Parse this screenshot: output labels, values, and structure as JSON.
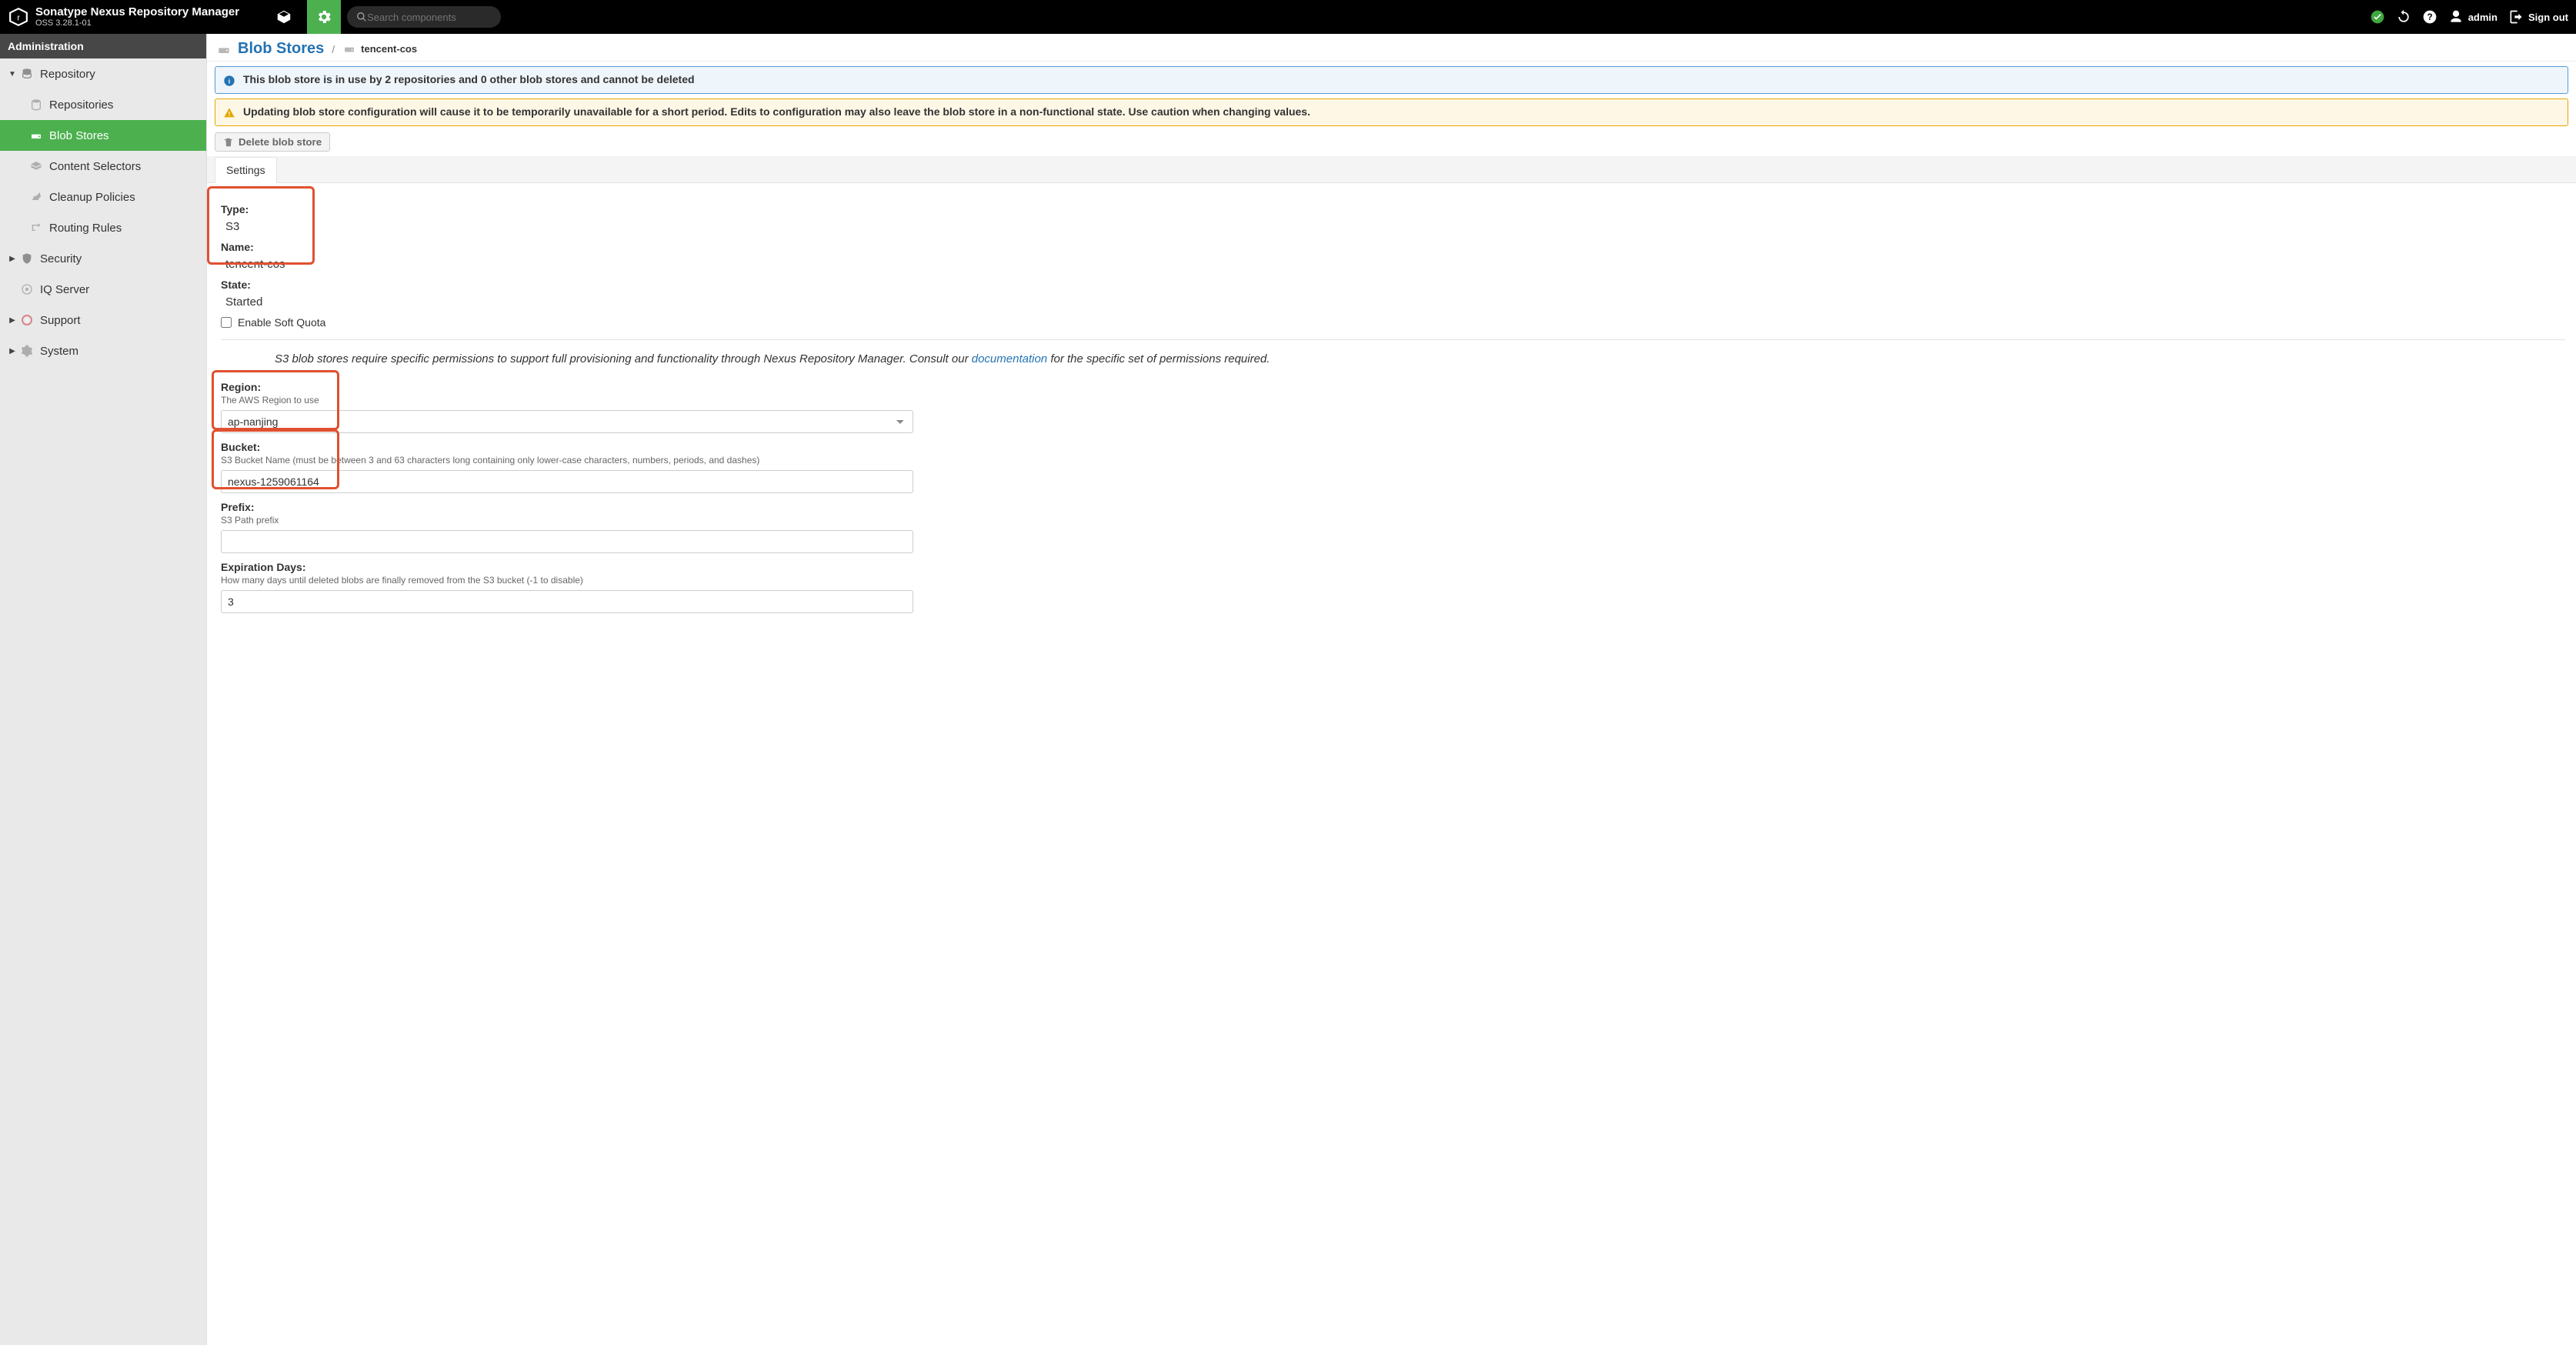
{
  "header": {
    "product_title": "Sonatype Nexus Repository Manager",
    "product_version": "OSS 3.28.1-01",
    "search_placeholder": "Search components",
    "user_label": "admin",
    "signout_label": "Sign out"
  },
  "sidebar": {
    "title": "Administration",
    "tree": {
      "repository": {
        "label": "Repository",
        "expanded": true,
        "children": {
          "repositories": "Repositories",
          "blobstores": "Blob Stores",
          "contentselectors": "Content Selectors",
          "cleanup": "Cleanup Policies",
          "routing": "Routing Rules"
        }
      },
      "security": {
        "label": "Security"
      },
      "iqserver": {
        "label": "IQ Server"
      },
      "support": {
        "label": "Support"
      },
      "system": {
        "label": "System"
      }
    }
  },
  "breadcrumb": {
    "section": "Blob Stores",
    "item": "tencent-cos"
  },
  "alerts": {
    "info_text": "This blob store is in use by 2 repositories and 0 other blob stores and cannot be deleted",
    "warn_text": "Updating blob store configuration will cause it to be temporarily unavailable for a short period. Edits to configuration may also leave the blob store in a non-functional state. Use caution when changing values."
  },
  "actions": {
    "delete_label": "Delete blob store"
  },
  "tabs": {
    "settings": "Settings"
  },
  "form": {
    "type": {
      "label": "Type:",
      "value": "S3"
    },
    "name": {
      "label": "Name:",
      "value": "tencent-cos"
    },
    "state": {
      "label": "State:",
      "value": "Started"
    },
    "soft_quota": {
      "label": "Enable Soft Quota"
    },
    "s3_note_prefix": "S3 blob stores require specific permissions to support full provisioning and functionality through Nexus Repository Manager. Consult our ",
    "s3_note_link": "documentation",
    "s3_note_suffix": " for the specific set of permissions required.",
    "region": {
      "label": "Region:",
      "hint": "The AWS Region to use",
      "value": "ap-nanjing"
    },
    "bucket": {
      "label": "Bucket:",
      "hint": "S3 Bucket Name (must be between 3 and 63 characters long containing only lower-case characters, numbers, periods, and dashes)",
      "value": "nexus-1259061164"
    },
    "prefix": {
      "label": "Prefix:",
      "hint": "S3 Path prefix",
      "value": ""
    },
    "expiration": {
      "label": "Expiration Days:",
      "hint": "How many days until deleted blobs are finally removed from the S3 bucket (-1 to disable)",
      "value": "3"
    }
  }
}
